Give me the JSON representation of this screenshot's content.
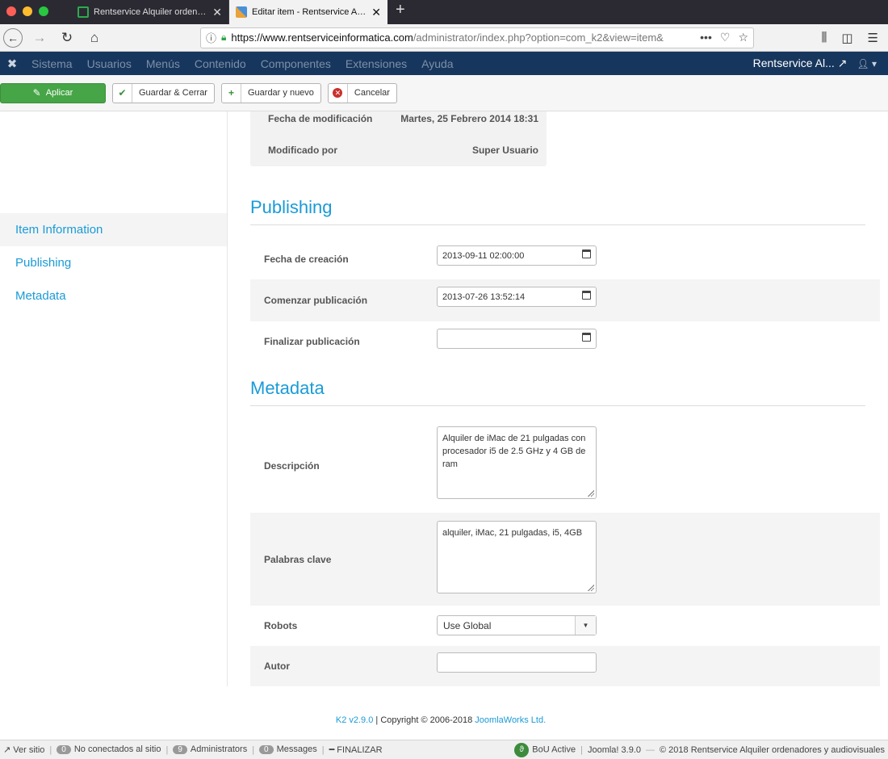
{
  "browser": {
    "tabs": [
      {
        "title": "Rentservice Alquiler ordenadores",
        "close": "✕"
      },
      {
        "title": "Editar item - Rentservice Alquiler",
        "close": "✕"
      }
    ],
    "new_tab": "+",
    "url_host": "https://www.rentserviceinformatica.com",
    "url_path": "/administrator/index.php?option=com_k2&view=item&"
  },
  "admin_menu": {
    "items": [
      "Sistema",
      "Usuarios",
      "Menús",
      "Contenido",
      "Componentes",
      "Extensiones",
      "Ayuda"
    ],
    "site_name": "Rentservice Al..."
  },
  "toolbar": {
    "apply": "Aplicar",
    "save_close": "Guardar & Cerrar",
    "save_new": "Guardar y nuevo",
    "cancel": "Cancelar"
  },
  "sidebar": {
    "items": [
      "Item Information",
      "Publishing",
      "Metadata"
    ]
  },
  "info": {
    "modified_label": "Fecha de modificación",
    "modified_value": "Martes, 25 Febrero 2014 18:31",
    "modified_by_label": "Modificado por",
    "modified_by_value": "Super Usuario"
  },
  "publishing": {
    "title": "Publishing",
    "created_label": "Fecha de creación",
    "created_value": "2013-09-11 02:00:00",
    "publish_up_label": "Comenzar publicación",
    "publish_up_value": "2013-07-26 13:52:14",
    "publish_down_label": "Finalizar publicación",
    "publish_down_value": ""
  },
  "metadata": {
    "title": "Metadata",
    "description_label": "Descripción",
    "description_value": "Alquiler de iMac de 21 pulgadas con procesador i5 de 2.5 GHz y 4 GB de ram",
    "keywords_label": "Palabras clave",
    "keywords_value": "alquiler, iMac, 21 pulgadas, i5, 4GB",
    "robots_label": "Robots",
    "robots_value": "Use Global",
    "author_label": "Autor",
    "author_value": ""
  },
  "footer": {
    "k2_version": "K2 v2.9.0",
    "copyright": " | Copyright © 2006-2018 ",
    "company": "JoomlaWorks Ltd."
  },
  "statusbar": {
    "view_site": "Ver sitio",
    "not_connected_count": "0",
    "not_connected_label": "No conectados al sitio",
    "admins_count": "9",
    "admins_label": "Administrators",
    "messages_count": "0",
    "messages_label": "Messages",
    "logout": "FINALIZAR",
    "bou": "BoU Active",
    "joomla_version": "Joomla! 3.9.0",
    "site_copyright": "© 2018 Rentservice Alquiler ordenadores y audiovisuales"
  }
}
